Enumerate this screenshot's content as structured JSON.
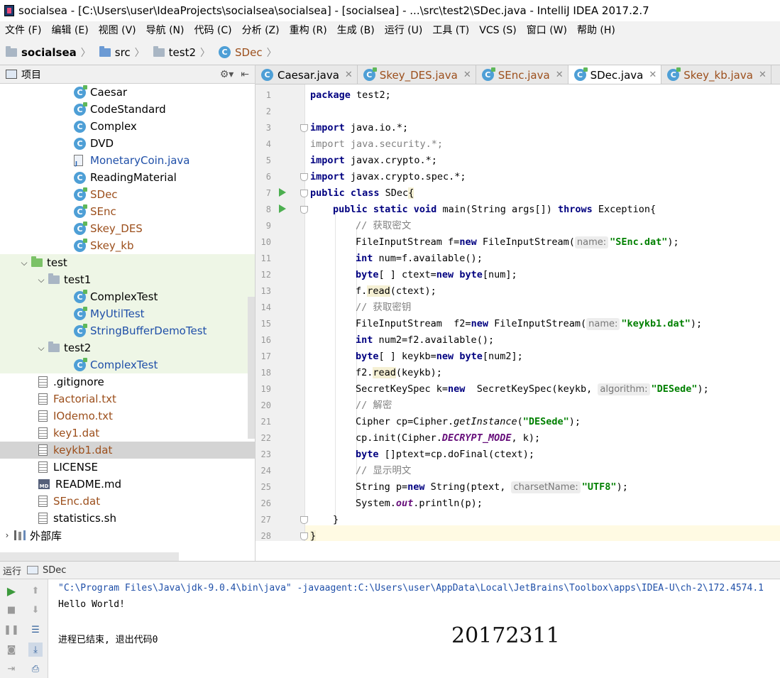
{
  "window": {
    "title": "socialsea - [C:\\Users\\user\\IdeaProjects\\socialsea\\socialsea] - [socialsea] - ...\\src\\test2\\SDec.java - IntelliJ IDEA 2017.2.7"
  },
  "menu": [
    "文件 (F)",
    "编辑 (E)",
    "视图 (V)",
    "导航 (N)",
    "代码 (C)",
    "分析 (Z)",
    "重构 (R)",
    "生成 (B)",
    "运行 (U)",
    "工具 (T)",
    "VCS (S)",
    "窗口 (W)",
    "帮助 (H)"
  ],
  "breadcrumb": [
    "socialsea",
    "src",
    "test2",
    "SDec"
  ],
  "project_panel": {
    "title": "项目",
    "items": [
      {
        "label": "Caesar"
      },
      {
        "label": "CodeStandard"
      },
      {
        "label": "Complex"
      },
      {
        "label": "DVD"
      },
      {
        "label": "MonetaryCoin.java"
      },
      {
        "label": "ReadingMaterial"
      },
      {
        "label": "SDec"
      },
      {
        "label": "SEnc"
      },
      {
        "label": "Skey_DES"
      },
      {
        "label": "Skey_kb"
      },
      {
        "label": "test"
      },
      {
        "label": "test1"
      },
      {
        "label": "ComplexTest"
      },
      {
        "label": "MyUtilTest"
      },
      {
        "label": "StringBufferDemoTest"
      },
      {
        "label": "test2"
      },
      {
        "label": "ComplexTest"
      },
      {
        "label": ".gitignore"
      },
      {
        "label": "Factorial.txt"
      },
      {
        "label": "IOdemo.txt"
      },
      {
        "label": "key1.dat"
      },
      {
        "label": "keykb1.dat"
      },
      {
        "label": "LICENSE"
      },
      {
        "label": "README.md"
      },
      {
        "label": "SEnc.dat"
      },
      {
        "label": "statistics.sh"
      },
      {
        "label": "外部库"
      }
    ]
  },
  "tabs": [
    "Caesar.java",
    "Skey_DES.java",
    "SEnc.java",
    "SDec.java",
    "Skey_kb.java"
  ],
  "editor": {
    "line_numbers": [
      "1",
      "2",
      "3",
      "4",
      "5",
      "6",
      "7",
      "8",
      "9",
      "10",
      "11",
      "12",
      "13",
      "14",
      "15",
      "16",
      "17",
      "18",
      "19",
      "20",
      "21",
      "22",
      "23",
      "24",
      "25",
      "26",
      "27",
      "28"
    ],
    "hints": {
      "name": "name:",
      "algorithm": "algorithm:",
      "charset": "charsetName:"
    },
    "code": {
      "l1a": "package",
      "l1b": " test2;",
      "l3a": "import",
      "l3b": " java.io.*;",
      "l4a": "import",
      "l4b": " java.security.*;",
      "l5a": "import",
      "l5b": " javax.crypto.*;",
      "l6a": "import",
      "l6b": " javax.crypto.spec.*;",
      "l7a": "public class",
      "l7b": " SDec",
      "l7c": "{",
      "l8a": "public static void",
      "l8b": " main(String args[]) ",
      "l8c": "throws",
      "l8d": " Exception{",
      "l9": "// 获取密文",
      "l10a": "FileInputStream f=",
      "l10b": "new",
      "l10c": " FileInputStream(",
      "l10s": "\"SEnc.dat\"",
      "l10e": ");",
      "l11a": "int",
      "l11b": " num=f.available();",
      "l12a": "byte",
      "l12b": "[ ] ctext=",
      "l12c": "new",
      "l12d": " ",
      "l12e": "byte",
      "l12f": "[num];",
      "l13a": "f.",
      "l13b": "read",
      "l13c": "(ctext);",
      "l14": "// 获取密钥",
      "l15a": "FileInputStream  f2=",
      "l15b": "new",
      "l15c": " FileInputStream(",
      "l15s": "\"keykb1.dat\"",
      "l15e": ");",
      "l16a": "int",
      "l16b": " num2=f2.available();",
      "l17a": "byte",
      "l17b": "[ ] keykb=",
      "l17c": "new",
      "l17d": " ",
      "l17e": "byte",
      "l17f": "[num2];",
      "l18a": "f2.",
      "l18b": "read",
      "l18c": "(keykb);",
      "l19a": "SecretKeySpec k=",
      "l19b": "new",
      "l19c": "  SecretKeySpec(keykb, ",
      "l19s": "\"DESede\"",
      "l19e": ");",
      "l20": "// 解密",
      "l21a": "Cipher cp=Cipher.",
      "l21b": "getInstance",
      "l21c": "(",
      "l21s": "\"DESede\"",
      "l21e": ");",
      "l22a": "cp.init(Cipher.",
      "l22b": "DECRYPT_MODE",
      "l22c": ", k);",
      "l23a": "byte",
      "l23b": " []ptext=cp.doFinal(ctext);",
      "l24": "// 显示明文",
      "l25a": "String p=",
      "l25b": "new",
      "l25c": " String(ptext, ",
      "l25s": "\"UTF8\"",
      "l25e": ");",
      "l26a": "System.",
      "l26b": "out",
      "l26c": ".println(p);",
      "l27": "}",
      "l28": "}"
    }
  },
  "run_panel": {
    "label": "运行",
    "config": "SDec",
    "console": [
      "\"C:\\Program Files\\Java\\jdk-9.0.4\\bin\\java\" -javaagent:C:\\Users\\user\\AppData\\Local\\JetBrains\\Toolbox\\apps\\IDEA-U\\ch-2\\172.4574.1",
      "Hello World!",
      "",
      "进程已结束, 退出代码0"
    ]
  },
  "overlay_text": "20172311",
  "colors": {
    "keyword": "#000080",
    "string": "#008000",
    "comment": "#808080",
    "run_green": "#4caf50"
  }
}
